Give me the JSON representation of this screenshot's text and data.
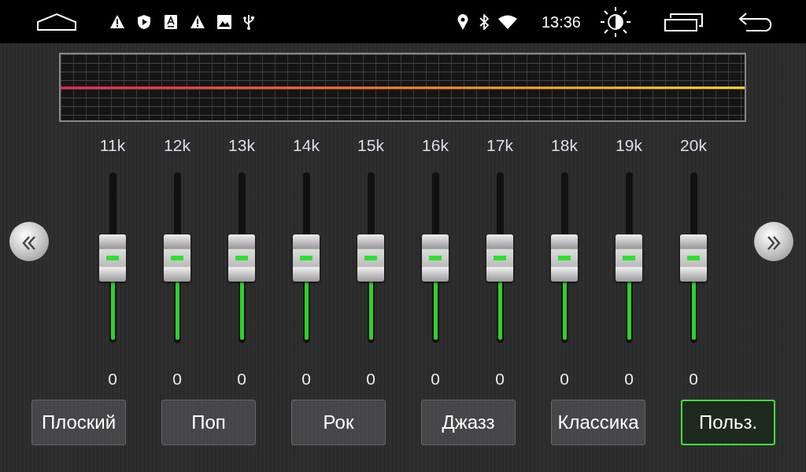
{
  "status_bar": {
    "time": "13:36"
  },
  "bands": [
    {
      "label": "11k",
      "level": 0.5,
      "value": "0"
    },
    {
      "label": "12k",
      "level": 0.5,
      "value": "0"
    },
    {
      "label": "13k",
      "level": 0.5,
      "value": "0"
    },
    {
      "label": "14k",
      "level": 0.5,
      "value": "0"
    },
    {
      "label": "15k",
      "level": 0.5,
      "value": "0"
    },
    {
      "label": "16k",
      "level": 0.5,
      "value": "0"
    },
    {
      "label": "17k",
      "level": 0.5,
      "value": "0"
    },
    {
      "label": "18k",
      "level": 0.5,
      "value": "0"
    },
    {
      "label": "19k",
      "level": 0.5,
      "value": "0"
    },
    {
      "label": "20k",
      "level": 0.5,
      "value": "0"
    }
  ],
  "presets": [
    {
      "label": "Плоский",
      "selected": false
    },
    {
      "label": "Поп",
      "selected": false
    },
    {
      "label": "Рок",
      "selected": false
    },
    {
      "label": "Джазз",
      "selected": false
    },
    {
      "label": "Классика",
      "selected": false
    },
    {
      "label": "Польз.",
      "selected": true
    }
  ]
}
